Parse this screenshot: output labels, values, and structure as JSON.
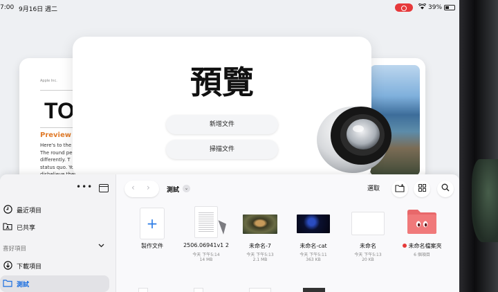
{
  "status_bar": {
    "time": "7:00",
    "date": "9月16日 週二",
    "battery": "39%"
  },
  "welcome": {
    "app_title": "預覽",
    "new_document": "新增文件",
    "scan_document": "掃描文件",
    "sample_doc": {
      "small_text": "Apple Inc.",
      "big_text": "TO",
      "heading": "Preview",
      "body": "Here's to the c\nThe round pe\ndifferently. T\nstatus quo. Yo\ndisbelieve them"
    }
  },
  "files": {
    "sidebar": {
      "recent": "最近項目",
      "shared": "已共享",
      "favorites": "喜好項目",
      "downloads": "下載項目",
      "test": "測試"
    },
    "toolbar": {
      "folder_title": "測試",
      "select": "選取"
    },
    "items": [
      {
        "name": "製作文件",
        "meta1": "",
        "meta2": ""
      },
      {
        "name": "2506.06941v1 2",
        "meta1": "今天 下午5:14",
        "meta2": "14 MB"
      },
      {
        "name": "未命名-7",
        "meta1": "今天 下午5:13",
        "meta2": "2.1 MB"
      },
      {
        "name": "未命名-cat",
        "meta1": "今天 下午5:11",
        "meta2": "363 KB"
      },
      {
        "name": "未命名",
        "meta1": "今天 下午5:13",
        "meta2": "20 KB"
      },
      {
        "name": "未命名檔案夾",
        "meta1": "6 個項目",
        "meta2": ""
      }
    ]
  },
  "colors": {
    "accent": "#1a6ee0",
    "folder_tag": "#e53a3a",
    "folder": "#f0797a"
  }
}
